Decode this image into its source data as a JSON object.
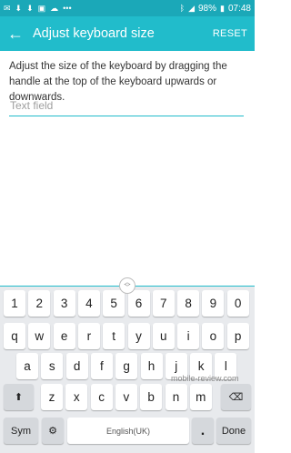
{
  "status_bar": {
    "battery": "98%",
    "time": "07:48"
  },
  "app_bar": {
    "title": "Adjust keyboard size",
    "reset": "RESET"
  },
  "content": {
    "description": "Adjust the size of the keyboard by dragging the handle at the top of the keyboard upwards or downwards.",
    "text_field_placeholder": "Text field"
  },
  "keyboard": {
    "number_row": [
      "1",
      "2",
      "3",
      "4",
      "5",
      "6",
      "7",
      "8",
      "9",
      "0"
    ],
    "row1": [
      "q",
      "w",
      "e",
      "r",
      "t",
      "y",
      "u",
      "i",
      "o",
      "p"
    ],
    "row2": [
      "a",
      "s",
      "d",
      "f",
      "g",
      "h",
      "j",
      "k",
      "l"
    ],
    "row3": [
      "z",
      "x",
      "c",
      "v",
      "b",
      "n",
      "m"
    ],
    "sym_label": "Sym",
    "space_label": "English(UK)",
    "period_label": ".",
    "done_label": "Done"
  },
  "watermark": "mobile-review.com",
  "colors": {
    "status_bar": "#1ba8b8",
    "app_bar": "#21bccb",
    "keyboard_bg": "#e8eaed",
    "fn_key": "#d5d8dc"
  }
}
